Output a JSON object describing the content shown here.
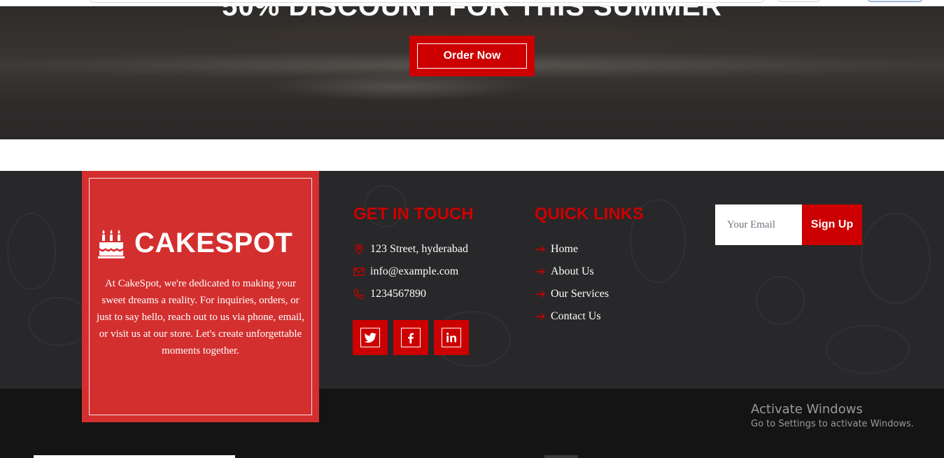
{
  "hero": {
    "title": "50% DISCOUNT FOR THIS SUMMER",
    "order_button": "Order Now"
  },
  "brand": {
    "name": "CAKESPOT",
    "icon": "birthday-cake-icon",
    "description": "At CakeSpot, we're dedicated to making your sweet dreams a reality. For inquiries, orders, or just to say hello, reach out to us via phone, email, or visit us at our store. Let's create unforgettable moments together."
  },
  "contact": {
    "title": "GET IN TOUCH",
    "items": [
      {
        "icon": "map-pin-icon",
        "text": "123 Street, hyderabad"
      },
      {
        "icon": "envelope-icon",
        "text": "info@example.com"
      },
      {
        "icon": "phone-icon",
        "text": "1234567890"
      }
    ],
    "social": [
      {
        "icon": "twitter-icon"
      },
      {
        "icon": "facebook-icon"
      },
      {
        "icon": "linkedin-icon"
      }
    ]
  },
  "quick_links": {
    "title": "QUICK LINKS",
    "items": [
      "Home",
      "About Us",
      "Our Services",
      "Contact Us"
    ]
  },
  "newsletter": {
    "placeholder": "Your Email",
    "button": "Sign Up"
  },
  "watermark": {
    "title": "Activate Windows",
    "subtitle": "Go to Settings to activate Windows."
  },
  "colors": {
    "accent": "#cc0000",
    "brand_card": "#d32f2f",
    "footer_bg": "#282729",
    "bottom_bar": "#141414"
  }
}
